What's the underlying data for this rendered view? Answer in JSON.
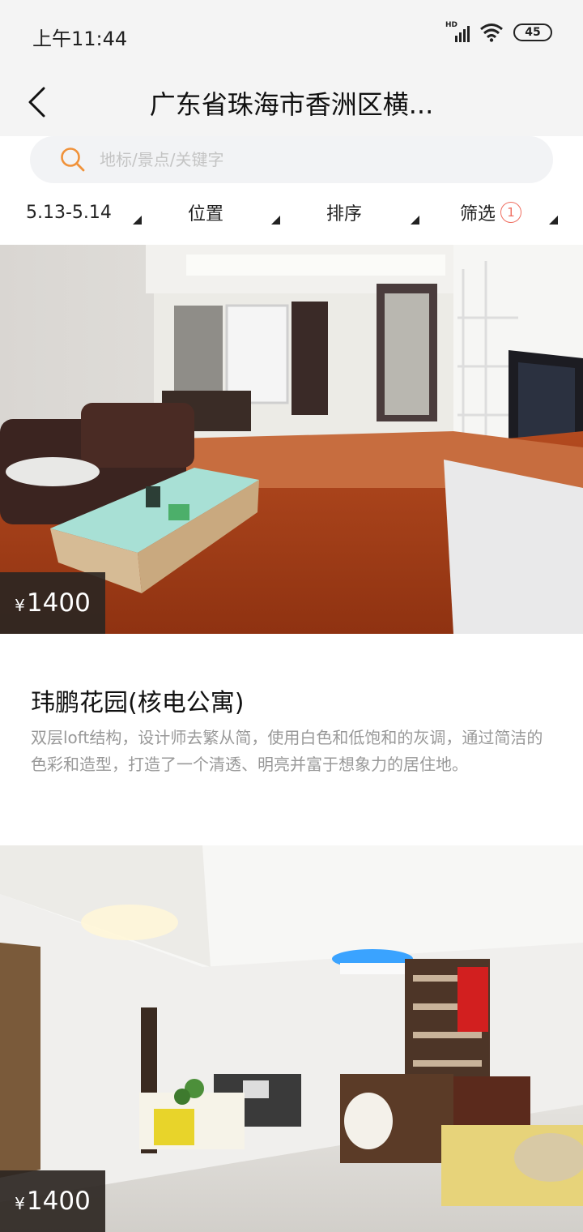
{
  "status_bar": {
    "time": "上午11:44",
    "network_label": "HD",
    "battery": "45"
  },
  "header": {
    "title": "广东省珠海市香洲区横..."
  },
  "search": {
    "placeholder": "地标/景点/关键字",
    "icon": "search-icon",
    "accent_color": "#f0923a"
  },
  "filters": [
    {
      "label": "5.13-5.14"
    },
    {
      "label": "位置"
    },
    {
      "label": "排序"
    },
    {
      "label": "筛选",
      "badge": "1"
    }
  ],
  "listings": [
    {
      "price_symbol": "¥",
      "price": "1400",
      "name": "玮鹏花园(核电公寓)",
      "description": "双层loft结构，设计师去繁从简，使用白色和低饱和的灰调，通过简洁的色彩和造型，打造了一个清透、明亮并富于想象力的居住地。"
    },
    {
      "price_symbol": "¥",
      "price": "1400"
    }
  ]
}
